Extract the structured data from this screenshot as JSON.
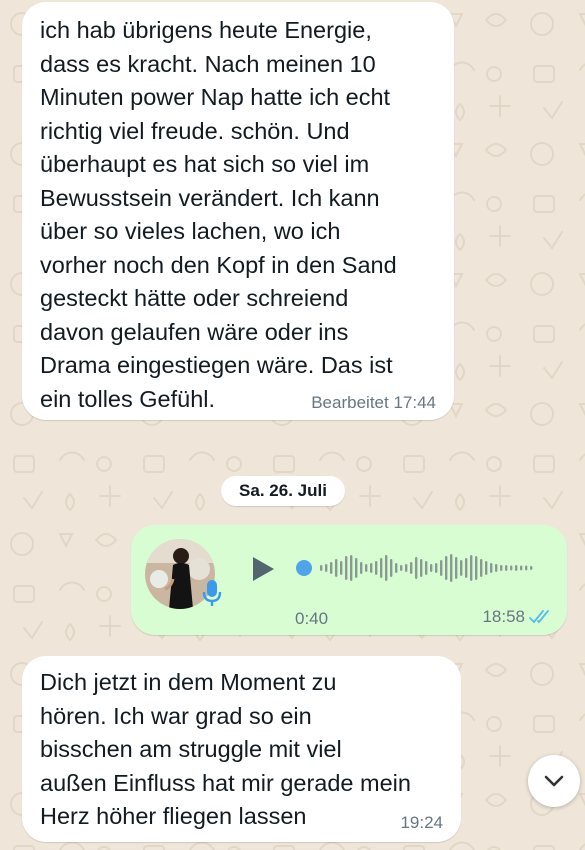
{
  "chat": {
    "messages": [
      {
        "direction": "incoming",
        "text": "ich hab übrigens heute Energie,\ndass es kracht. Nach meinen 10\nMinuten power Nap hatte ich echt\nrichtig viel freude. schön. Und\nüberhaupt es hat sich so viel im\nBewusstsein verändert. Ich kann\nüber so vieles lachen, wo ich\nvorher noch den Kopf in den Sand\ngesteckt hätte oder schreiend\ndavon gelaufen wäre oder ins\nDrama eingestiegen wäre. Das ist\nein tolles Gefühl.",
        "edited_label": "Bearbeitet",
        "time": "17:44"
      },
      {
        "direction": "incoming",
        "text": "Dich jetzt in dem Moment zu\nhören. Ich war grad so ein\nbisschen am struggle mit viel\naußen Einfluss hat mir gerade mein\nHerz höher fliegen lassen",
        "time": "19:24"
      }
    ],
    "date_separator": "Sa. 26. Juli",
    "voice_message": {
      "direction": "outgoing",
      "duration": "0:40",
      "time": "18:58",
      "read_status": "read",
      "playback_progress": 0,
      "icons": [
        "avatar",
        "microphone-icon",
        "play-icon",
        "waveform",
        "double-check-icon"
      ]
    }
  },
  "colors": {
    "wallpaper": "#efe6d9",
    "incoming_bubble": "#ffffff",
    "outgoing_bubble": "#d9fdd3",
    "read_ticks": "#53bdeb",
    "waveform_progress": "#4fa3e8",
    "waveform": "#8a9a93"
  },
  "controls": {
    "scroll_down_icon": "chevron-down-icon"
  }
}
